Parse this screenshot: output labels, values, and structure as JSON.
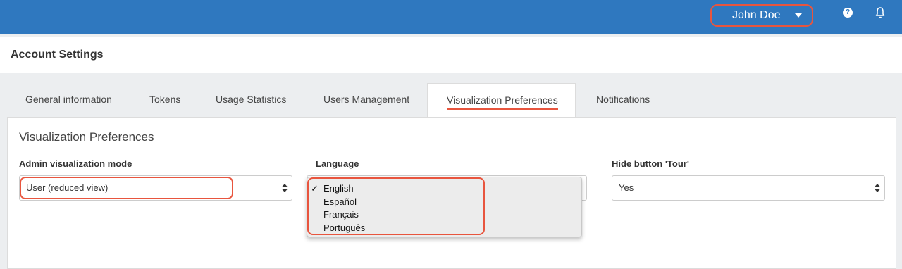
{
  "topbar": {
    "user_name": "John Doe",
    "help_icon": "question-circle-icon",
    "bell_icon": "bell-icon",
    "help_glyph": "?"
  },
  "header": {
    "title": "Account Settings"
  },
  "tabs": [
    {
      "label": "General information",
      "active": false
    },
    {
      "label": "Tokens",
      "active": false
    },
    {
      "label": "Usage Statistics",
      "active": false
    },
    {
      "label": "Users Management",
      "active": false
    },
    {
      "label": "Visualization Preferences",
      "active": true
    },
    {
      "label": "Notifications",
      "active": false
    }
  ],
  "section": {
    "title": "Visualization Preferences"
  },
  "fields": {
    "admin_mode": {
      "label": "Admin visualization mode",
      "value": "User (reduced view)"
    },
    "language": {
      "label": "Language",
      "value": "English",
      "options": [
        "English",
        "Español",
        "Français",
        "Português"
      ],
      "check": "✓"
    },
    "hide_tour": {
      "label": "Hide button 'Tour'",
      "value": "Yes"
    }
  },
  "colors": {
    "brand": "#2f78bf",
    "highlight": "#e8553e"
  }
}
